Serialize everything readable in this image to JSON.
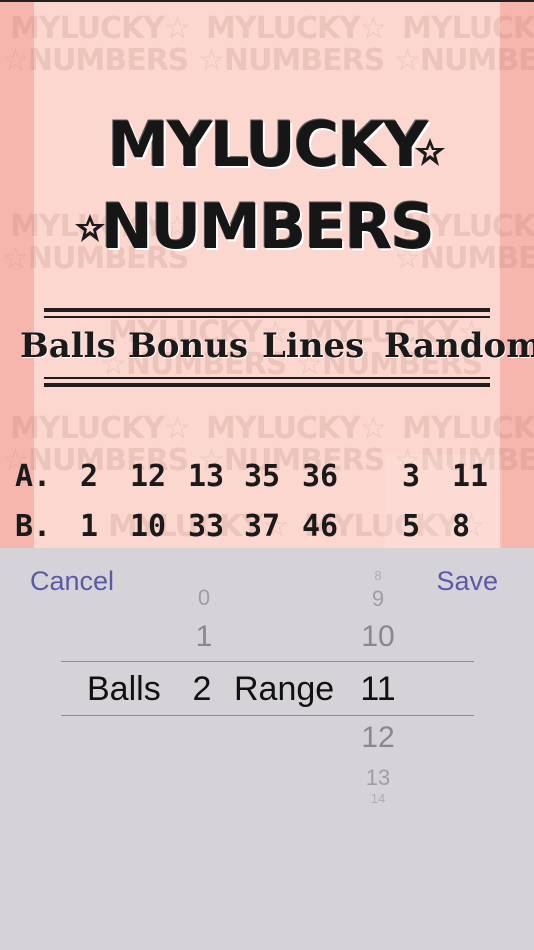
{
  "logo": {
    "line1": "MYLUCKY",
    "line2": "NUMBERS",
    "watermark_line1": "MYLUCKY☆",
    "watermark_line2": "☆NUMBERS"
  },
  "columns": [
    "Balls",
    "Bonus",
    "Lines",
    "Random"
  ],
  "rows": [
    {
      "label": "A.",
      "balls": [
        "2",
        "12",
        "13",
        "35",
        "36"
      ],
      "random": [
        "3",
        "11"
      ]
    },
    {
      "label": "B.",
      "balls": [
        "1",
        "10",
        "33",
        "37",
        "46"
      ],
      "random": [
        "5",
        "8"
      ]
    }
  ],
  "sheet": {
    "cancel_label": "Cancel",
    "save_label": "Save",
    "balls_label": "Balls",
    "range_label": "Range",
    "balls_wheel": {
      "above": [
        "0",
        "1"
      ],
      "selected": "2"
    },
    "range_wheel": {
      "above": [
        "8",
        "9",
        "10"
      ],
      "selected": "11",
      "below": [
        "12",
        "13",
        "14"
      ]
    }
  },
  "colors": {
    "background": "#fbd7cf",
    "side_strip": "#f6b6ad",
    "sheet": "#d6d3d8",
    "button_text": "#5a5aa8"
  }
}
